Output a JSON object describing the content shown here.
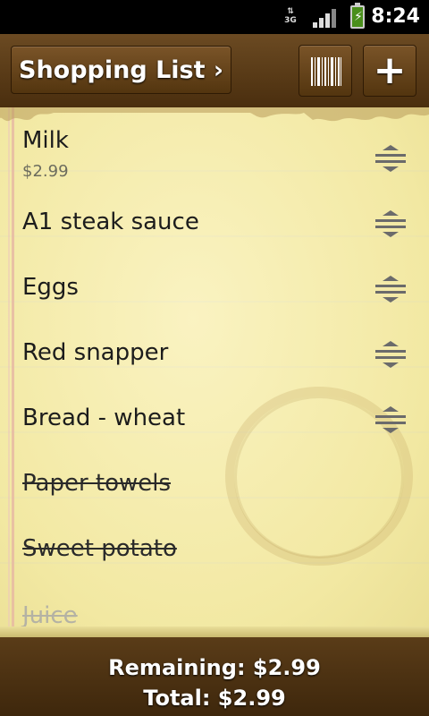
{
  "status_bar": {
    "network": "3G",
    "time": "8:24"
  },
  "header": {
    "title": "Shopping List ›",
    "barcode_icon": "barcode-icon",
    "add_icon": "plus-icon"
  },
  "items": [
    {
      "name": "Milk",
      "price": "$2.99",
      "checked": false
    },
    {
      "name": "A1 steak sauce",
      "checked": false
    },
    {
      "name": "Eggs",
      "checked": false
    },
    {
      "name": "Red snapper",
      "checked": false
    },
    {
      "name": "Bread - wheat",
      "checked": false
    },
    {
      "name": "Paper towels",
      "checked": true
    },
    {
      "name": "Sweet potato",
      "checked": true
    },
    {
      "name": "Juice",
      "checked": true
    }
  ],
  "footer": {
    "remaining": "Remaining: $2.99",
    "total": "Total: $2.99"
  }
}
